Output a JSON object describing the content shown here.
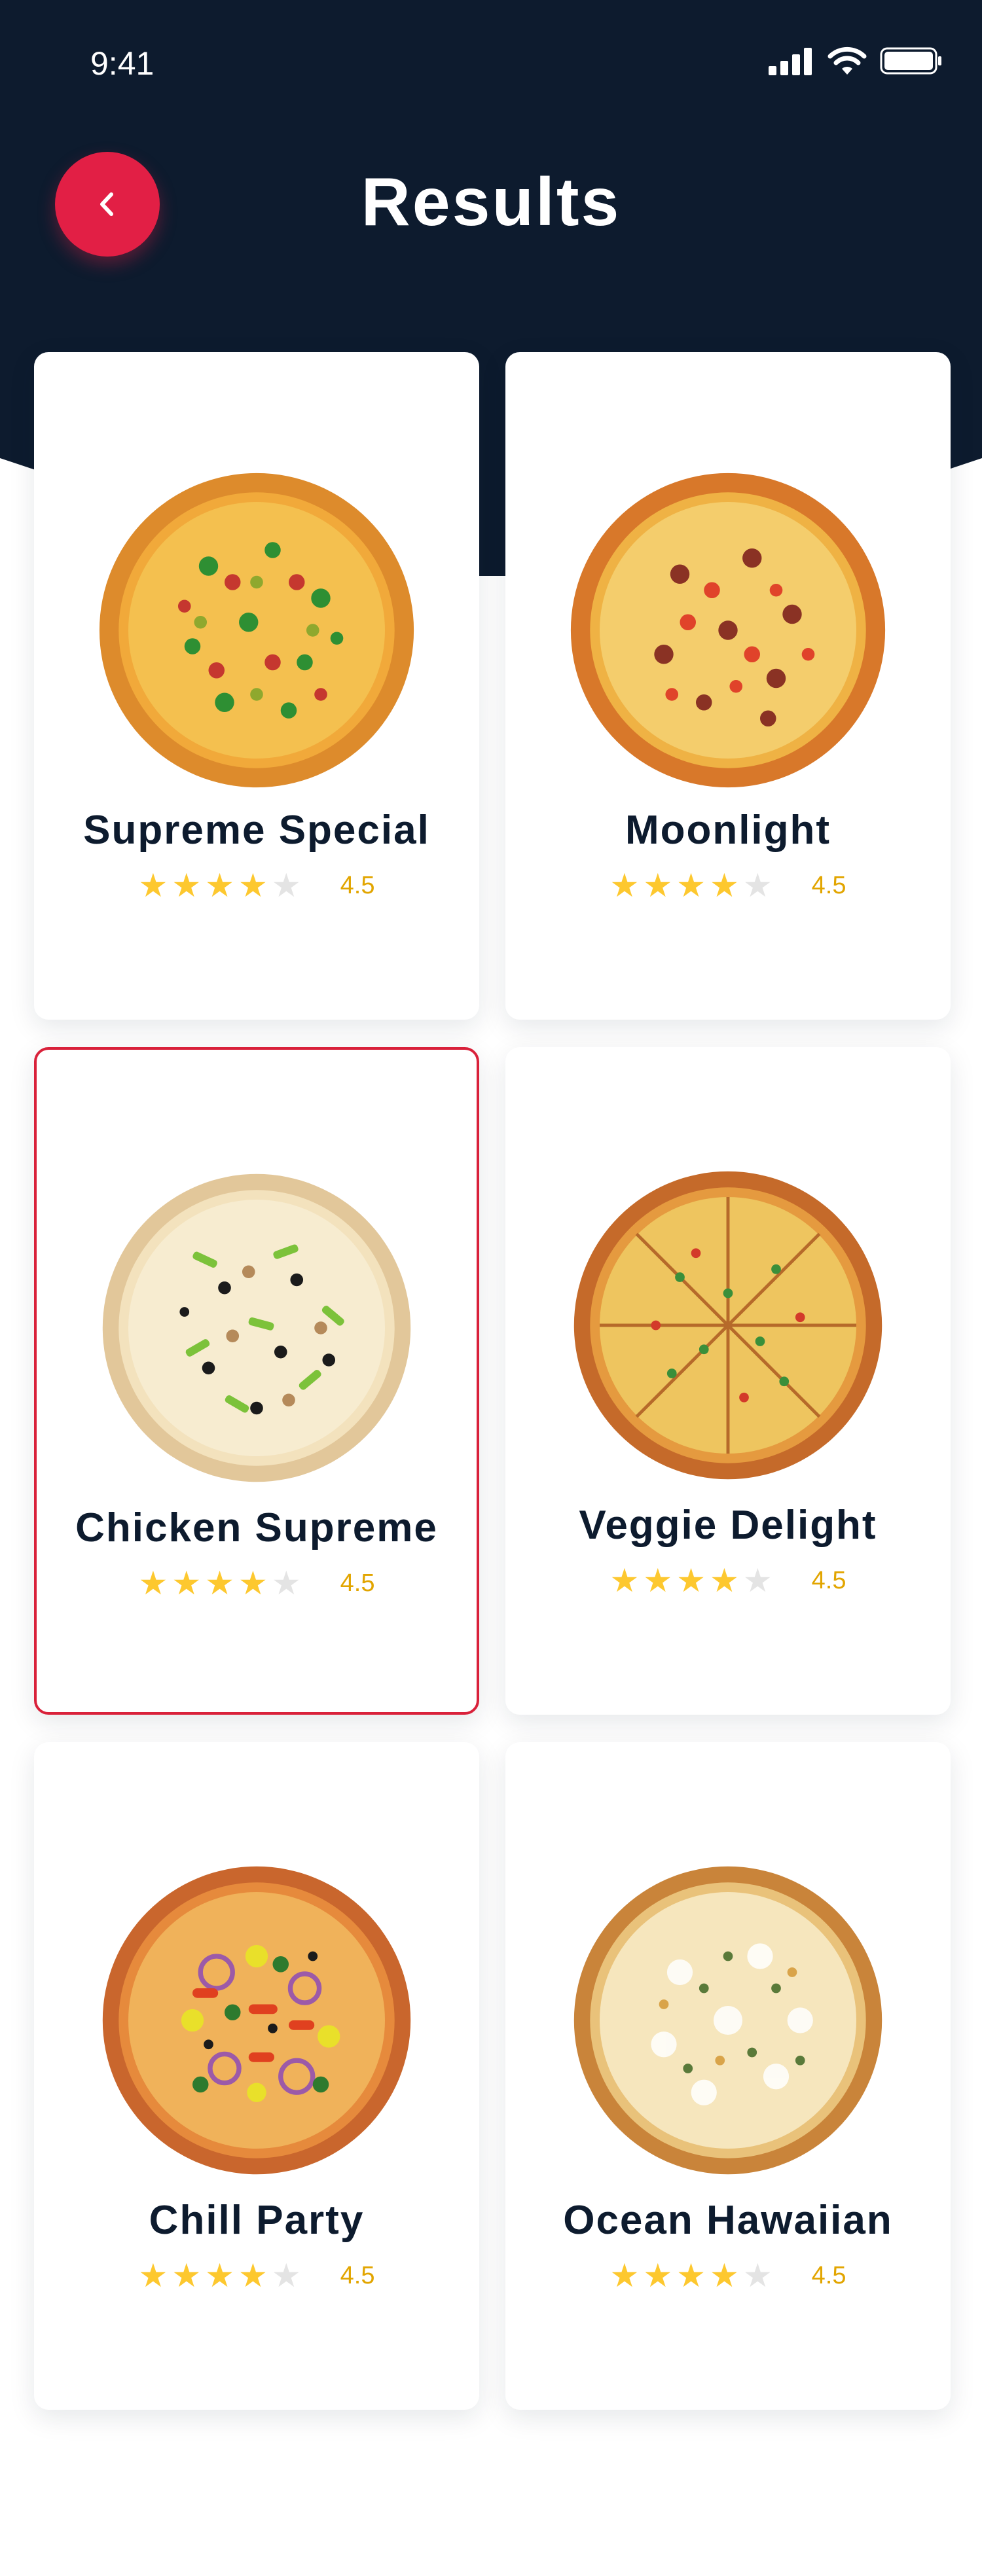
{
  "status_bar": {
    "time": "9:41"
  },
  "header": {
    "title": "Results"
  },
  "colors": {
    "header_bg": "#0d1b2e",
    "accent": "#e21f45",
    "star": "#fdc82f",
    "rating_text": "#e2a500"
  },
  "pizzas": [
    {
      "name": "Supreme Special",
      "rating": "4.5",
      "stars_filled": 4,
      "selected": false
    },
    {
      "name": "Moonlight",
      "rating": "4.5",
      "stars_filled": 4,
      "selected": false
    },
    {
      "name": "Chicken Supreme",
      "rating": "4.5",
      "stars_filled": 4,
      "selected": true
    },
    {
      "name": "Veggie Delight",
      "rating": "4.5",
      "stars_filled": 4,
      "selected": false
    },
    {
      "name": "Chill Party",
      "rating": "4.5",
      "stars_filled": 4,
      "selected": false
    },
    {
      "name": "Ocean Hawaiian",
      "rating": "4.5",
      "stars_filled": 4,
      "selected": false
    }
  ]
}
